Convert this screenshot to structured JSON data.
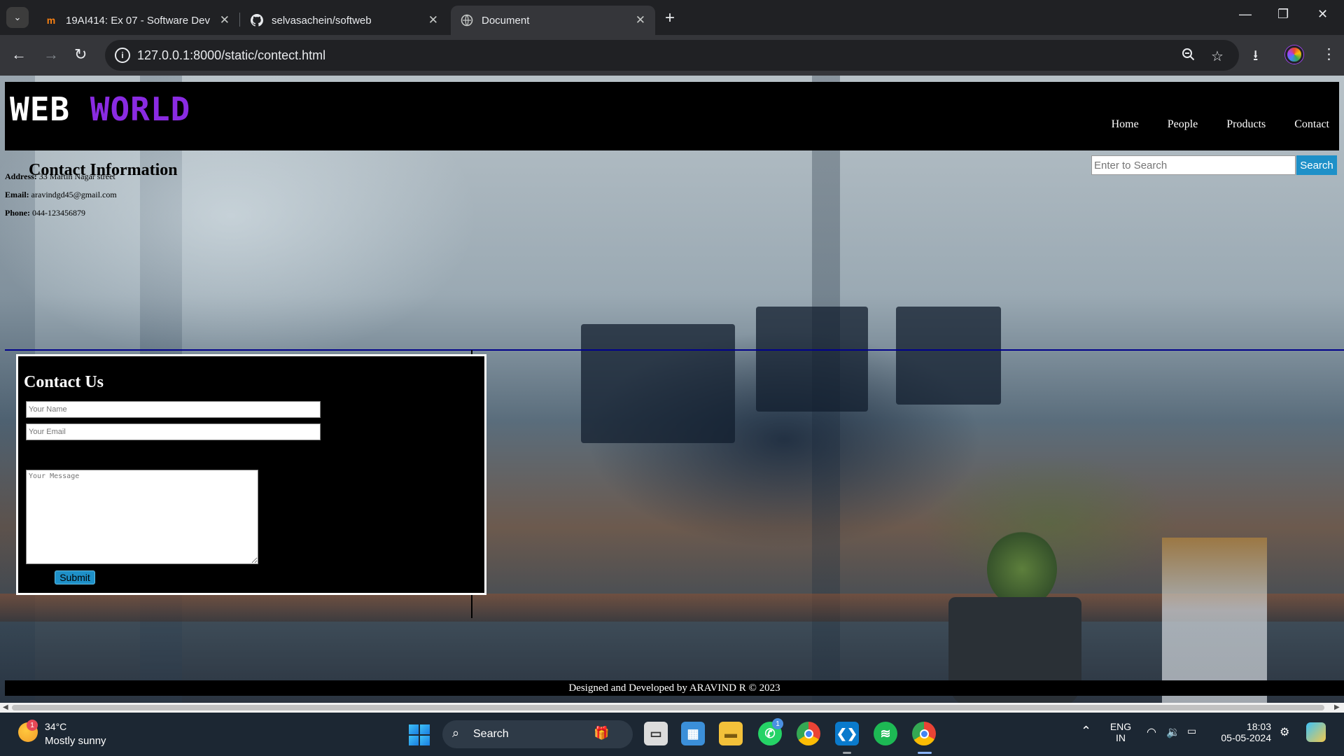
{
  "browser": {
    "tabs": [
      {
        "title": "19AI414: Ex 07 - Software Deve",
        "icon": "moodle-icon",
        "active": false
      },
      {
        "title": "selvasachein/softweb",
        "icon": "github-icon",
        "active": false
      },
      {
        "title": "Document",
        "icon": "globe-icon",
        "active": true
      }
    ],
    "url": "127.0.0.1:8000/static/contect.html"
  },
  "site": {
    "logo_part1": "WEB",
    "logo_part2": "WORLD",
    "nav": [
      "Home",
      "People",
      "Products",
      "Contact"
    ],
    "search_placeholder": "Enter to Search",
    "search_button": "Search",
    "contact_info": {
      "title": "Contact Information",
      "address_label": "Address:",
      "address": "33 Martin Nagar street",
      "email_label": "Email:",
      "email": "aravindgd45@gmail.com",
      "phone_label": "Phone:",
      "phone": "044-123456879"
    },
    "form": {
      "title": "Contact Us",
      "name_placeholder": "Your Name",
      "email_placeholder": "Your Email",
      "message_placeholder": "Your Message",
      "submit": "Submit"
    },
    "footer": "Designed and Developed by ARAVIND R © 2023",
    "accent_color": "#8a2be2",
    "button_color": "#1e90c8"
  },
  "taskbar": {
    "weather_temp": "34°C",
    "weather_desc": "Mostly sunny",
    "weather_badge": "1",
    "search_label": "Search",
    "whatsapp_badge": "1",
    "lang_top": "ENG",
    "lang_bottom": "IN",
    "time": "18:03",
    "date": "05-05-2024"
  }
}
